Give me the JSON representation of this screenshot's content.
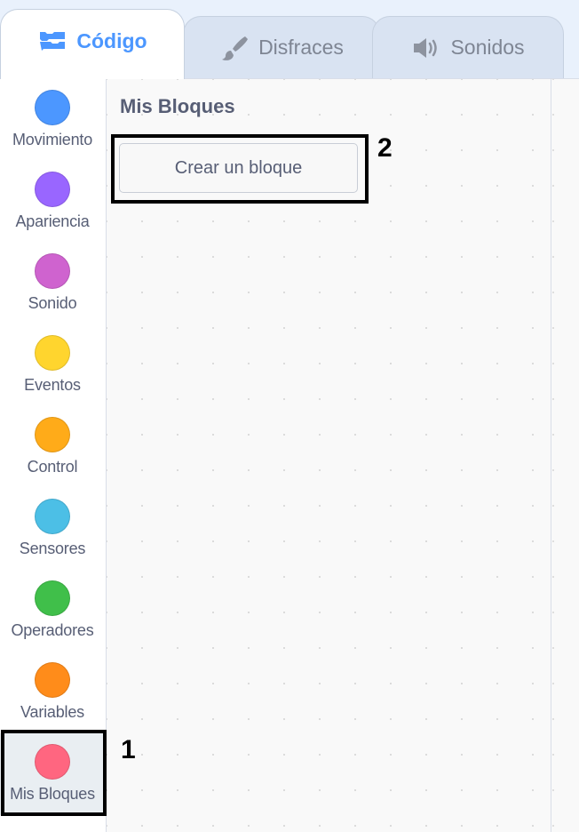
{
  "tabs": [
    {
      "label": "Código",
      "icon": "code-blocks-icon",
      "active": true
    },
    {
      "label": "Disfraces",
      "icon": "paintbrush-icon",
      "active": false
    },
    {
      "label": "Sonidos",
      "icon": "speaker-icon",
      "active": false
    }
  ],
  "categories": [
    {
      "label": "Movimiento",
      "color": "#4c97ff"
    },
    {
      "label": "Apariencia",
      "color": "#9966ff"
    },
    {
      "label": "Sonido",
      "color": "#cf63cf"
    },
    {
      "label": "Eventos",
      "color": "#ffd52e"
    },
    {
      "label": "Control",
      "color": "#ffab19"
    },
    {
      "label": "Sensores",
      "color": "#4cbfe6"
    },
    {
      "label": "Operadores",
      "color": "#40bf4a"
    },
    {
      "label": "Variables",
      "color": "#ff8c1a"
    },
    {
      "label": "Mis Bloques",
      "color": "#ff6680",
      "selected": true
    }
  ],
  "palette": {
    "title": "Mis Bloques",
    "make_block_label": "Crear un bloque"
  },
  "annotations": {
    "marker_1": "1",
    "marker_2": "2"
  },
  "colors": {
    "accent": "#4c97ff",
    "text": "#575e75",
    "tab_inactive_text": "#7e8593"
  }
}
